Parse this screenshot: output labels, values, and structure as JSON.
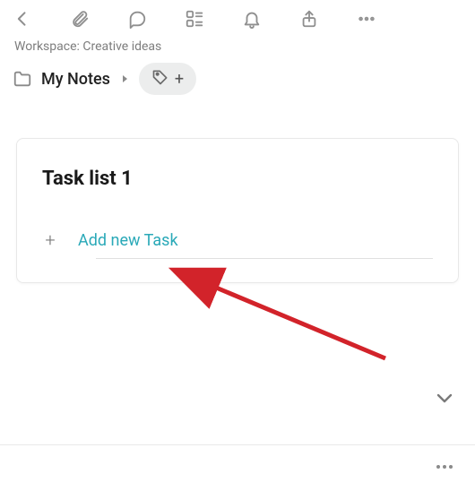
{
  "workspace_label": "Workspace: Creative ideas",
  "note_title": "My Notes",
  "tasklist": {
    "title": "Task list 1",
    "add_label": "Add new Task"
  },
  "add_plus": "+"
}
